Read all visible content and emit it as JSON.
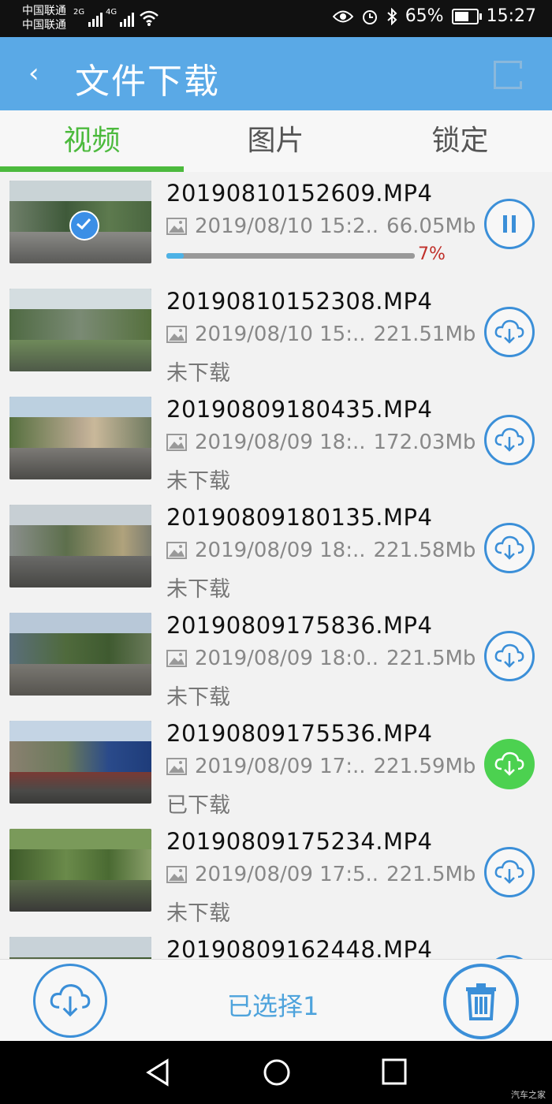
{
  "status_bar": {
    "carrier1": "中国联通",
    "carrier2": "中国联通",
    "net1": "2G",
    "net2": "4G",
    "battery": "65%",
    "time": "15:27"
  },
  "app_bar": {
    "back_symbol": "‹",
    "title": "文件下载"
  },
  "tabs": [
    {
      "label": "视频",
      "active": true
    },
    {
      "label": "图片",
      "active": false
    },
    {
      "label": "锁定",
      "active": false
    }
  ],
  "files": [
    {
      "name": "20190810152609.MP4",
      "date": "2019/08/10 15:2..",
      "size": "66.05Mb",
      "state": "downloading",
      "progress_percent": 7,
      "progress_label": "7%",
      "status": "",
      "selected": true
    },
    {
      "name": "20190810152308.MP4",
      "date": "2019/08/10 15:..",
      "size": "221.51Mb",
      "state": "not_downloaded",
      "status": "未下载",
      "selected": false
    },
    {
      "name": "20190809180435.MP4",
      "date": "2019/08/09 18:..",
      "size": "172.03Mb",
      "state": "not_downloaded",
      "status": "未下载",
      "selected": false
    },
    {
      "name": "20190809180135.MP4",
      "date": "2019/08/09 18:..",
      "size": "221.58Mb",
      "state": "not_downloaded",
      "status": "未下载",
      "selected": false
    },
    {
      "name": "20190809175836.MP4",
      "date": "2019/08/09 18:0..",
      "size": "221.5Mb",
      "state": "not_downloaded",
      "status": "未下载",
      "selected": false
    },
    {
      "name": "20190809175536.MP4",
      "date": "2019/08/09 17:..",
      "size": "221.59Mb",
      "state": "downloaded",
      "status": "已下载",
      "selected": false
    },
    {
      "name": "20190809175234.MP4",
      "date": "2019/08/09 17:5..",
      "size": "221.5Mb",
      "state": "not_downloaded",
      "status": "未下载",
      "selected": false
    },
    {
      "name": "20190809162448.MP4",
      "date": "",
      "size": "",
      "state": "not_downloaded",
      "status": "",
      "selected": false
    }
  ],
  "bottom_bar": {
    "selected_label": "已选择1"
  },
  "watermark": "汽车之家",
  "colors": {
    "app_bar": "#5aa9e6",
    "tab_active": "#4cba3d",
    "action_blue": "#3b8fd8",
    "downloaded_green": "#4cd150",
    "progress_red": "#c0302a"
  }
}
